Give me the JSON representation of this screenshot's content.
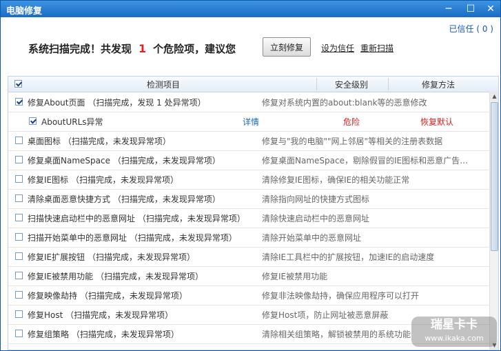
{
  "window": {
    "title": "电脑修复",
    "minimize": "─",
    "maximize": "☐",
    "close": "✕"
  },
  "trusted": "已信任 ( 0 )",
  "summary": {
    "prefix": "系统扫描完成！共发现",
    "count": "1",
    "suffix": "个危险项，建议您"
  },
  "buttons": {
    "fix_now": "立刻修复",
    "set_trust": "设为信任",
    "rescan": "重新扫描"
  },
  "table": {
    "headers": {
      "item": "检测项目",
      "level": "安全级别",
      "method": "修复方法"
    },
    "rows": [
      {
        "name": "修复About页面",
        "status": "（扫描完成，发现 1 处异常项）",
        "desc": "修复对系统内置的about:blank等的恶意修改"
      },
      {
        "name": "桌面图标",
        "status": "（扫描完成，未发现异常项）",
        "desc": "修复与\"我的电脑\"\"网上邻居\"等相关的注册表数据"
      },
      {
        "name": "修复桌面NameSpace",
        "status": "（扫描完成，未发现异常项）",
        "desc": "修复桌面NameSpace，剔除假冒的IE图标和恶意广告链..."
      },
      {
        "name": "修复IE图标",
        "status": "（扫描完成，未发现异常项）",
        "desc": "清除修复IE图标，确保IE的相关功能正常"
      },
      {
        "name": "清除桌面恶意快捷方式",
        "status": "（扫描完成，未发现异常项）",
        "desc": "清除指向网址的快捷方式图标"
      },
      {
        "name": "扫描快速启动栏中的恶意网址",
        "status": "（扫描完成，未发现异常项）",
        "desc": "清除快速启动栏中的恶意网址"
      },
      {
        "name": "扫描开始菜单中的恶意网址",
        "status": "（扫描完成，未发现异常项）",
        "desc": "清除开始菜单中的恶意网址"
      },
      {
        "name": "修复IE扩展按钮",
        "status": "（扫描完成，未发现异常项）",
        "desc": "清除IE工具栏中的扩展按钮，加速IE的启动速度"
      },
      {
        "name": "修复IE被禁用功能",
        "status": "（扫描完成，未发现异常项）",
        "desc": "修复IE被禁用功能"
      },
      {
        "name": "修复映像劫持",
        "status": "（扫描完成，未发现异常项）",
        "desc": "修复非法映像劫持，确保应用程序可以打开"
      },
      {
        "name": "修复Host",
        "status": "（扫描完成，未发现异常项）",
        "desc": "修复Host项，防止网址被恶意屏蔽"
      },
      {
        "name": "修复组策略",
        "status": "（扫描完成，未发现异常项）",
        "desc": "清除相关组策略，解锁被禁用的系统功能"
      }
    ],
    "subrow": {
      "name": "AboutURLs异常",
      "detail": "详情",
      "level": "危险",
      "restore": "恢复默认"
    }
  },
  "watermark": {
    "big": "瑞星卡卡",
    "small": "www.ikaka.com"
  }
}
